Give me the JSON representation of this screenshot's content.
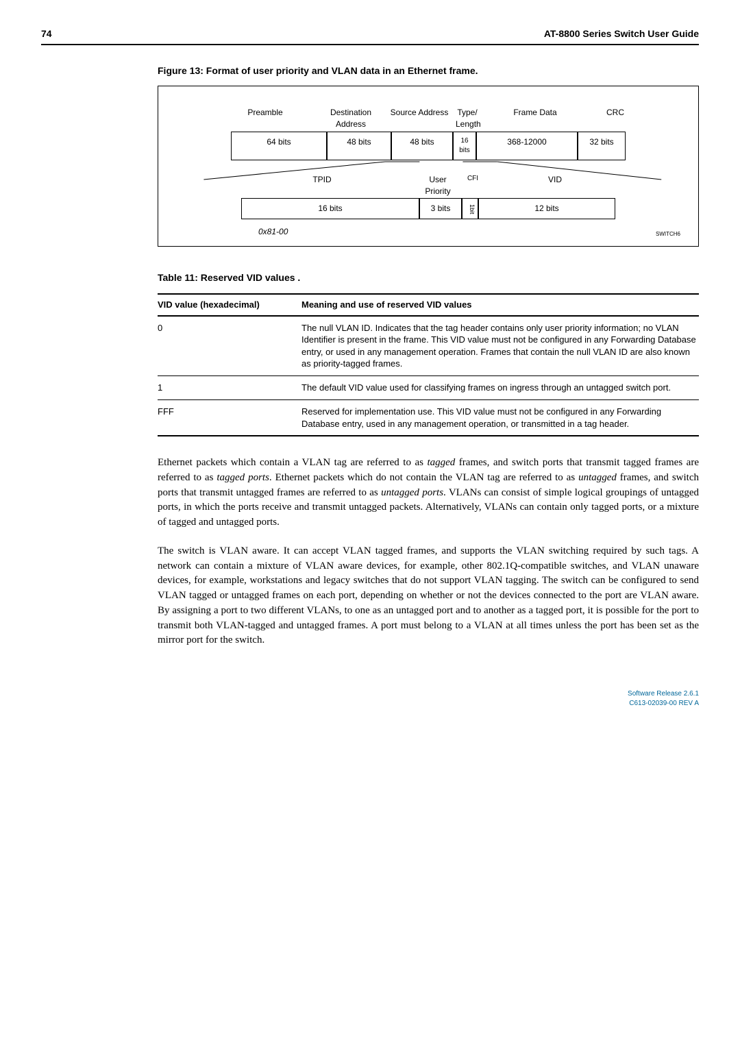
{
  "header": {
    "page": "74",
    "title": "AT-8800 Series Switch User Guide"
  },
  "figure": {
    "caption": "Figure 13: Format of user priority and VLAN data in an Ethernet frame.",
    "top_labels": {
      "preamble": "Preamble",
      "dest": "Destination Address",
      "src": "Source Address",
      "type": "Type/ Length",
      "fd": "Frame Data",
      "crc": "CRC"
    },
    "top_values": {
      "preamble": "64 bits",
      "dest": "48 bits",
      "src": "48 bits",
      "type": "16 bits",
      "fd": "368-12000",
      "crc": "32 bits"
    },
    "bot_labels": {
      "tpid": "TPID",
      "up": "User Priority",
      "cfi": "CFI",
      "vid": "VID"
    },
    "bot_values": {
      "tpid": "16 bits",
      "up": "3 bits",
      "cfi": "1bit",
      "vid": "12 bits"
    },
    "hexnote": "0x81-00",
    "switch": "SWITCH6"
  },
  "table": {
    "caption": "Table 11: Reserved VID values .",
    "head": {
      "c1": "VID value (hexadecimal)",
      "c2": "Meaning and use of reserved VID values"
    },
    "rows": [
      {
        "c1": "0",
        "c2": "The null VLAN ID. Indicates that the tag header contains only user priority information; no VLAN Identifier is present in the frame. This VID value must not be configured in any Forwarding Database entry, or used in any management operation. Frames that contain the null VLAN ID are also known as priority-tagged frames."
      },
      {
        "c1": "1",
        "c2": "The default VID value used for classifying frames on ingress through an untagged switch port."
      },
      {
        "c1": "FFF",
        "c2": "Reserved for implementation use. This VID value must not be configured in any Forwarding Database entry, used in any management operation, or transmitted in a tag header."
      }
    ]
  },
  "para1": {
    "a": "Ethernet packets which contain a VLAN tag are referred to as ",
    "b": "tagged",
    "c": " frames, and switch ports that transmit tagged frames are referred to as ",
    "d": "tagged ports",
    "e": ". Ethernet packets which do not contain the VLAN tag are referred to as ",
    "f": "untagged",
    "g": " frames, and switch ports that transmit untagged frames are referred to as ",
    "h": "untagged ports",
    "i": ". VLANs can consist of simple logical groupings of untagged ports, in which the ports receive and transmit untagged packets. Alternatively, VLANs can contain only tagged ports, or a mixture of tagged and untagged ports."
  },
  "para2": "The switch is VLAN aware. It can accept VLAN tagged frames, and supports the VLAN switching required by such tags. A network can contain a mixture of VLAN aware devices, for example, other 802.1Q-compatible switches, and VLAN unaware devices, for example, workstations and legacy switches that do not support VLAN tagging. The switch can be configured to send VLAN tagged or untagged frames on each port, depending on whether or not the devices connected to the port are VLAN aware. By assigning a port to two different VLANs, to one as an untagged port and to another as a tagged port, it is possible for the port to transmit both VLAN-tagged and untagged frames. A port must belong to a VLAN at all times unless the port has been set as the mirror port for the switch.",
  "footer": {
    "line1": "Software Release 2.6.1",
    "line2": "C613-02039-00 REV A"
  }
}
